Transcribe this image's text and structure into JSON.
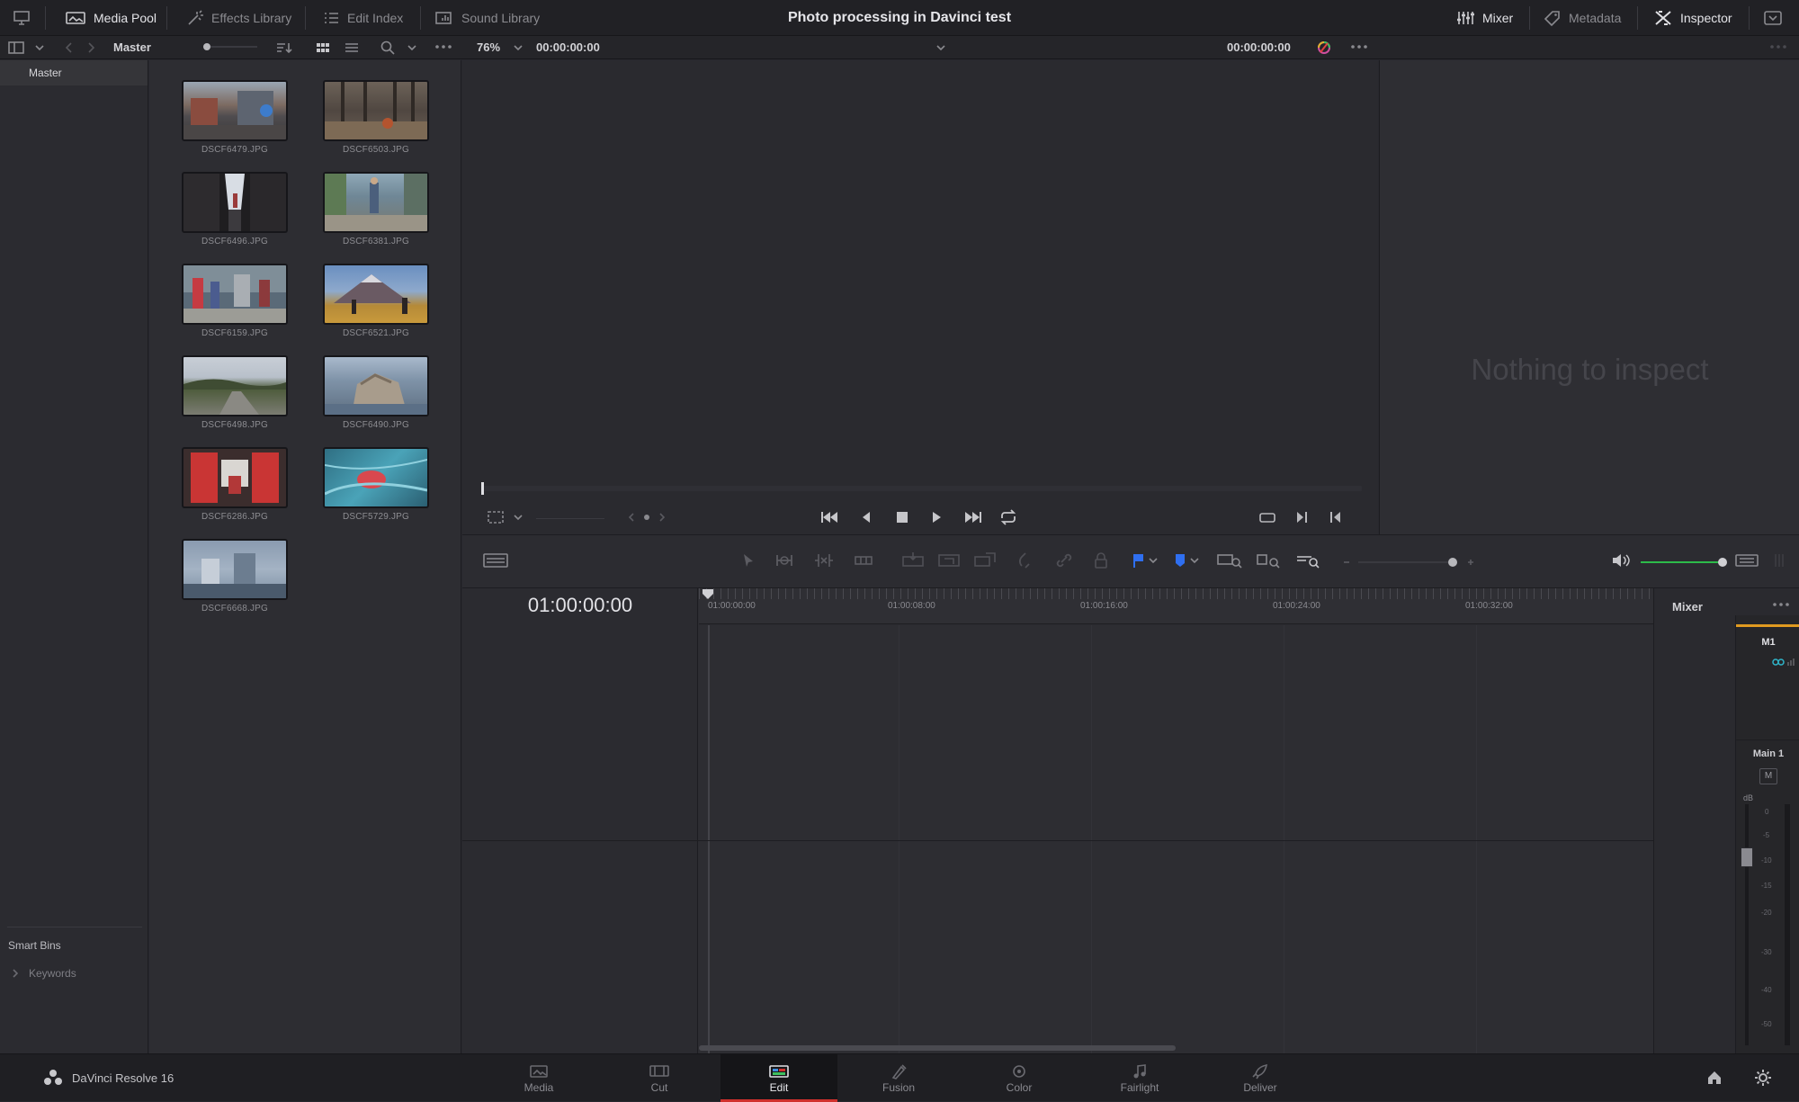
{
  "topbar": {
    "media_pool": "Media Pool",
    "effects_library": "Effects Library",
    "edit_index": "Edit Index",
    "sound_library": "Sound Library",
    "project_title": "Photo processing in Davinci test",
    "mixer": "Mixer",
    "metadata": "Metadata",
    "inspector": "Inspector"
  },
  "toolbar2": {
    "bin_name": "Master",
    "zoom": "76%",
    "source_timecode": "00:00:00:00",
    "record_timecode": "00:00:00:00"
  },
  "bins": {
    "master": "Master",
    "smart_bins": "Smart Bins",
    "keywords": "Keywords"
  },
  "clips": [
    {
      "name": "DSCF6479.JPG"
    },
    {
      "name": "DSCF6503.JPG"
    },
    {
      "name": "DSCF6496.JPG"
    },
    {
      "name": "DSCF6381.JPG"
    },
    {
      "name": "DSCF6159.JPG"
    },
    {
      "name": "DSCF6521.JPG"
    },
    {
      "name": "DSCF6498.JPG"
    },
    {
      "name": "DSCF6490.JPG"
    },
    {
      "name": "DSCF6286.JPG"
    },
    {
      "name": "DSCF5729.JPG"
    },
    {
      "name": "DSCF6668.JPG"
    }
  ],
  "inspector": {
    "empty_message": "Nothing to inspect"
  },
  "timeline": {
    "timecode": "01:00:00:00",
    "ruler": [
      "01:00:00:00",
      "01:00:08:00",
      "01:00:16:00",
      "01:00:24:00",
      "01:00:32:00"
    ]
  },
  "mixer": {
    "title": "Mixer",
    "track": "M1",
    "main": "Main 1",
    "m_button": "M",
    "db_unit": "dB",
    "scale": [
      "0",
      "-5",
      "-10",
      "-15",
      "-20",
      "-30",
      "-40",
      "-50"
    ]
  },
  "pagebar": {
    "app_name": "DaVinci Resolve 16",
    "pages": [
      "Media",
      "Cut",
      "Edit",
      "Fusion",
      "Color",
      "Fairlight",
      "Deliver"
    ],
    "active_page": "Edit"
  },
  "colors": {
    "accent_red": "#d0312d",
    "marker_blue": "#2f6ff0",
    "volume_green": "#2dbb4a",
    "meter_cyan": "#2fb5c9"
  }
}
